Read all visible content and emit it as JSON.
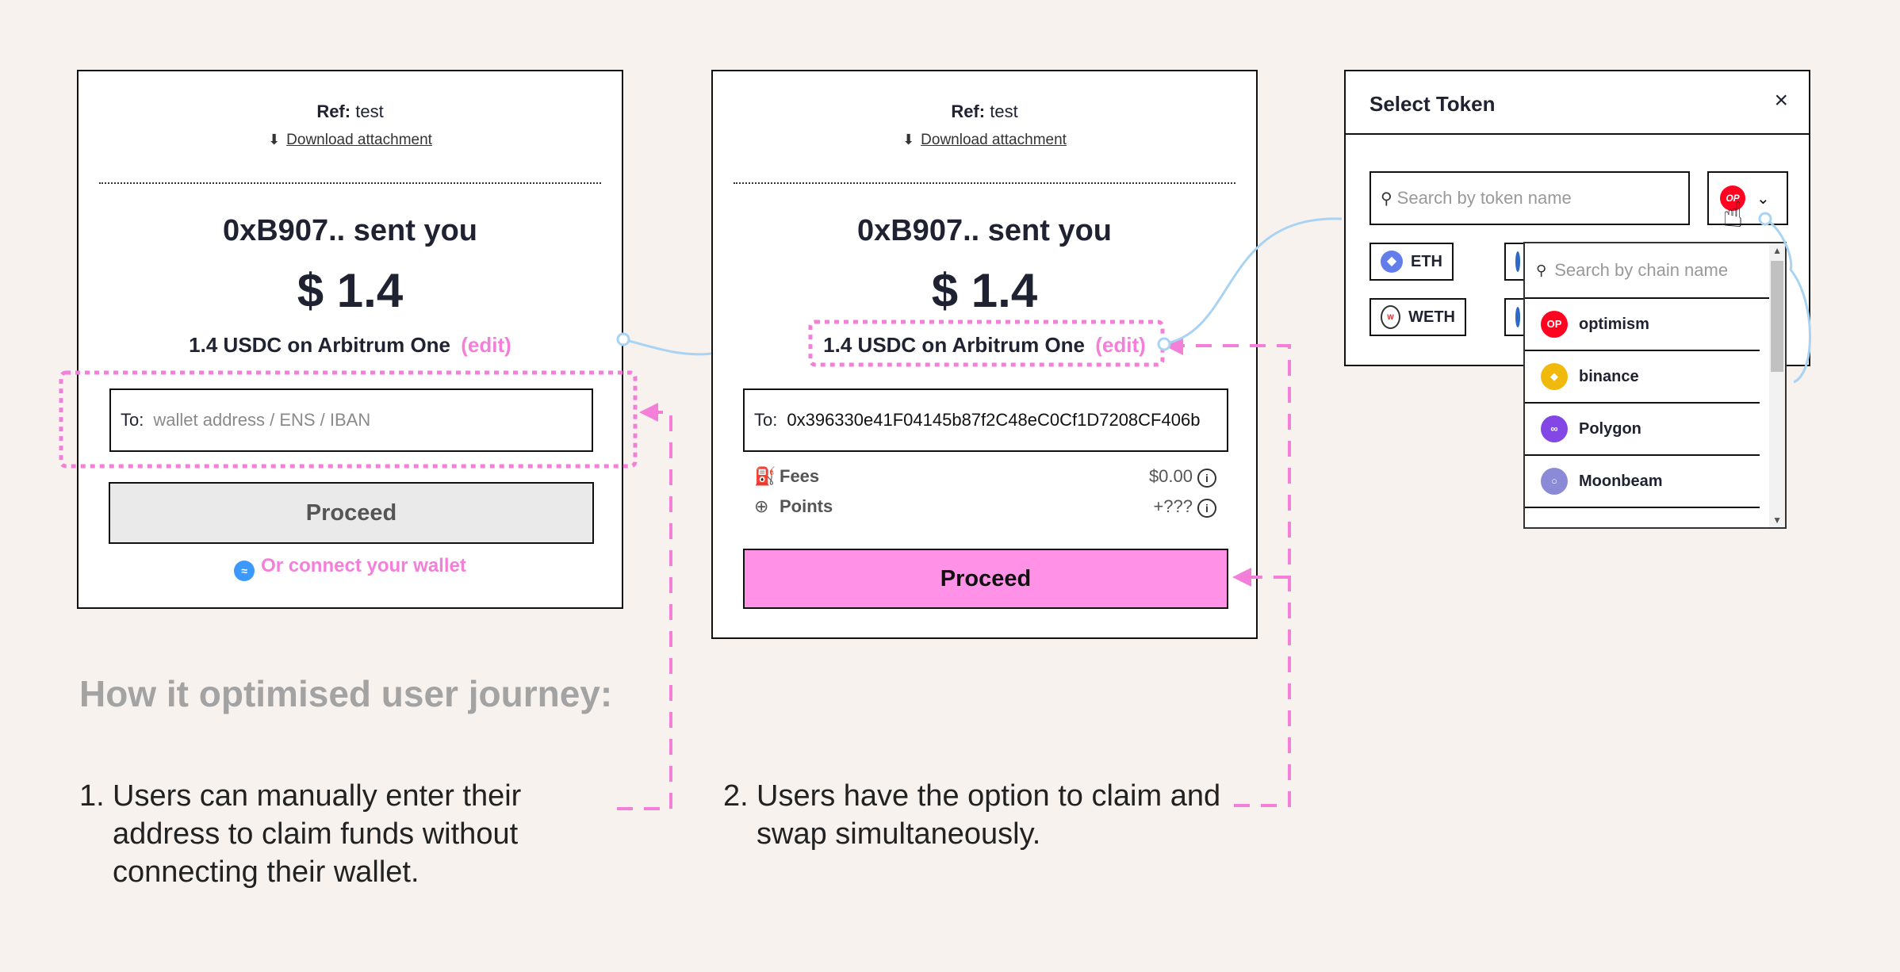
{
  "card_left": {
    "ref_label": "Ref:",
    "ref_value": "test",
    "download_label": "Download attachment",
    "sent_text": "0xB907.. sent you",
    "amount": "$ 1.4",
    "network_text": "1.4 USDC on Arbitrum One",
    "edit_label": "(edit)",
    "to_label": "To:",
    "to_placeholder": "wallet address / ENS / IBAN",
    "proceed_label": "Proceed",
    "connect_label": "Or connect your wallet"
  },
  "card_right": {
    "ref_label": "Ref:",
    "ref_value": "test",
    "download_label": "Download attachment",
    "sent_text": "0xB907.. sent you",
    "amount": "$ 1.4",
    "network_text": "1.4 USDC on Arbitrum One",
    "edit_label": "(edit)",
    "to_label": "To:",
    "to_value": "0x396330e41F04145b87f2C48eC0Cf1D7208CF406b",
    "fees_label": "Fees",
    "fees_value": "$0.00",
    "points_label": "Points",
    "points_value": "+???",
    "proceed_label": "Proceed"
  },
  "select_token": {
    "title": "Select Token",
    "close": "×",
    "search_placeholder": "Search by token name",
    "selected_chain_badge": "OP",
    "tokens": [
      "ETH",
      "WETH"
    ],
    "chain_search_placeholder": "Search by chain name",
    "chains": [
      {
        "name": "optimism",
        "color": "#ff0420",
        "badge": "OP"
      },
      {
        "name": "binance",
        "color": "#f0b90b",
        "badge": "◆"
      },
      {
        "name": "Polygon",
        "color": "#8247e5",
        "badge": "∞"
      },
      {
        "name": "Moonbeam",
        "color": "#8a8ad6",
        "badge": "○"
      }
    ]
  },
  "annotations": {
    "journey_title": "How it optimised user journey:",
    "note1_num": "1.",
    "note1_text": "Users can manually enter their address to claim funds without connecting their wallet.",
    "note2_num": "2.",
    "note2_text": "Users have the option to claim and swap simultaneously."
  },
  "colors": {
    "accent_pink": "#f37fd9",
    "proceed_pink": "#ff91e6",
    "background": "#f7f2ee",
    "connector_blue": "#a9d3f2"
  }
}
